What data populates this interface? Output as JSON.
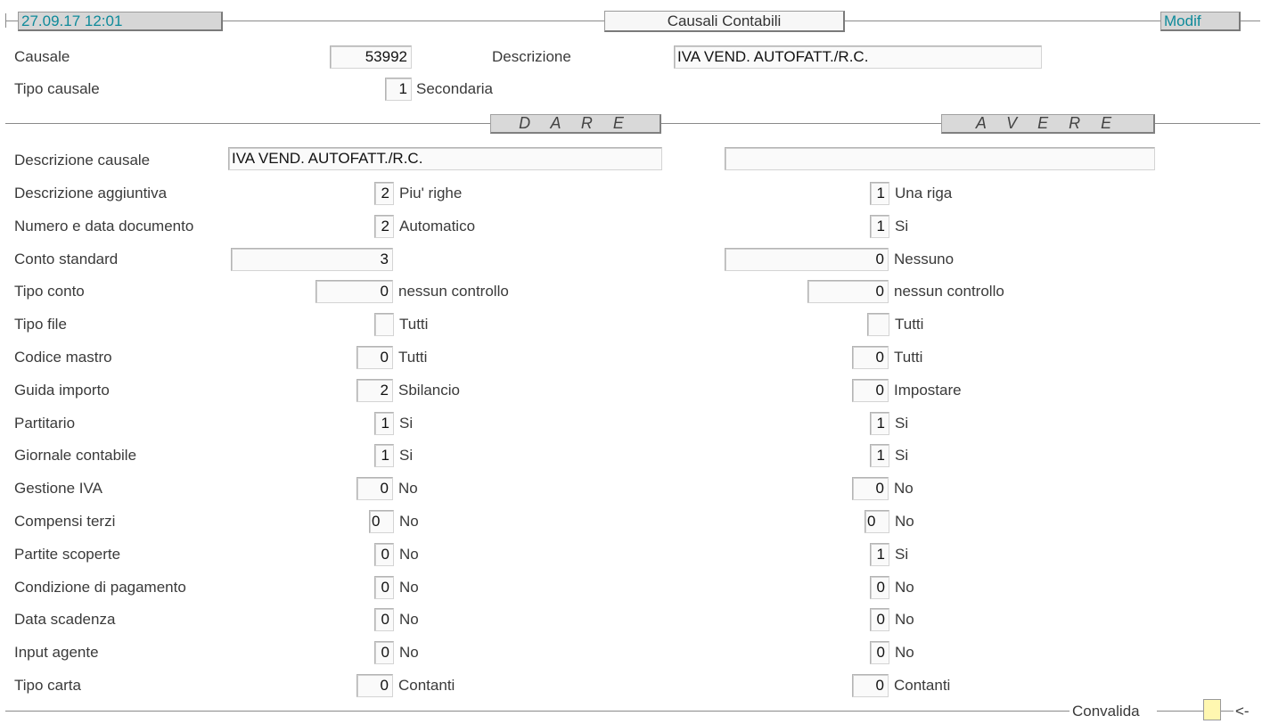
{
  "header": {
    "datetime": "27.09.17 12:01",
    "title": "Causali Contabili",
    "mode": "Modif"
  },
  "causale": {
    "label": "Causale",
    "value": "53992",
    "descrizione_label": "Descrizione",
    "descrizione_value": "IVA VEND. AUTOFATT./R.C.",
    "tipo_label": "Tipo causale",
    "tipo_value": "1",
    "tipo_desc": "Secondaria"
  },
  "sections": {
    "dare": "D A R E",
    "avere": "A V E R E"
  },
  "descrizione_causale": {
    "label": "Descrizione causale",
    "dare": "IVA VEND. AUTOFATT./R.C.",
    "avere": ""
  },
  "rows": [
    {
      "label": "Descrizione aggiuntiva",
      "dare_value": "2",
      "dare_desc": "Piu' righe",
      "avere_value": "1",
      "avere_desc": "Una riga"
    },
    {
      "label": "Numero e data documento",
      "dare_value": "2",
      "dare_desc": "Automatico",
      "avere_value": "1",
      "avere_desc": "Si"
    },
    {
      "label": "Conto standard",
      "dare_value": "3",
      "dare_desc": "",
      "avere_value": "0",
      "avere_desc": "Nessuno"
    },
    {
      "label": "Tipo conto",
      "dare_value": "0",
      "dare_desc": "nessun controllo",
      "avere_value": "0",
      "avere_desc": "nessun controllo"
    },
    {
      "label": "Tipo file",
      "dare_value": "",
      "dare_desc": "Tutti",
      "avere_value": "",
      "avere_desc": "Tutti"
    },
    {
      "label": "Codice mastro",
      "dare_value": "0",
      "dare_desc": "Tutti",
      "avere_value": "0",
      "avere_desc": "Tutti"
    },
    {
      "label": "Guida importo",
      "dare_value": "2",
      "dare_desc": "Sbilancio",
      "avere_value": "0",
      "avere_desc": "Impostare"
    },
    {
      "label": "Partitario",
      "dare_value": "1",
      "dare_desc": "Si",
      "avere_value": "1",
      "avere_desc": "Si"
    },
    {
      "label": "Giornale contabile",
      "dare_value": "1",
      "dare_desc": "Si",
      "avere_value": "1",
      "avere_desc": "Si"
    },
    {
      "label": "Gestione IVA",
      "dare_value": "0",
      "dare_desc": "No",
      "avere_value": "0",
      "avere_desc": "No"
    },
    {
      "label": "Compensi terzi",
      "dare_value": "0",
      "dare_desc": "No",
      "avere_value": "0",
      "avere_desc": "No"
    },
    {
      "label": "Partite scoperte",
      "dare_value": "0",
      "dare_desc": "No",
      "avere_value": "1",
      "avere_desc": "Si"
    },
    {
      "label": "Condizione di pagamento",
      "dare_value": "0",
      "dare_desc": "No",
      "avere_value": "0",
      "avere_desc": "No"
    },
    {
      "label": "Data scadenza",
      "dare_value": "0",
      "dare_desc": "No",
      "avere_value": "0",
      "avere_desc": "No"
    },
    {
      "label": "Input agente",
      "dare_value": "0",
      "dare_desc": "No",
      "avere_value": "0",
      "avere_desc": "No"
    },
    {
      "label": "Tipo carta",
      "dare_value": "0",
      "dare_desc": "Contanti",
      "avere_value": "0",
      "avere_desc": "Contanti"
    }
  ],
  "footer": {
    "convalida_label": "Convalida",
    "arrow": "<-"
  }
}
